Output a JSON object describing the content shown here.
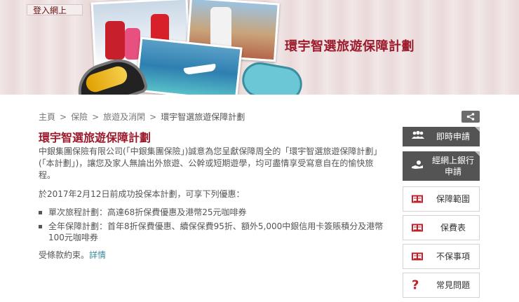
{
  "header": {
    "login_tab": "登入網上",
    "banner_title": "環宇智選旅遊保障計劃"
  },
  "breadcrumb": {
    "items": [
      "主頁",
      "保險",
      "旅遊及消閑"
    ],
    "current": "環宇智選旅遊保障計劃",
    "separator": ">"
  },
  "main": {
    "title": "環宇智選旅遊保障計劃",
    "intro": "中銀集團保險有限公司(「中銀集團保險」)誠意為您呈獻保障周全的「環宇智選旅遊保障計劃」(「本計劃」)，讓您及家人無論出外旅遊、公幹或短期遊學，均可盡情享受寫意自在的愉快旅程。",
    "offer_heading": "於2017年2月12日前成功投保本計劃，可享下列優惠：",
    "offers": [
      "單次旅程計劃：高達68折保費優惠及港幣25元咖啡券",
      "全年保障計劃：首年8折保費優惠、續保保費95折、額外5,000中銀信用卡簽賬積分及港幣100元咖啡券"
    ],
    "terms_text": "受條款約束。",
    "terms_link": "詳情"
  },
  "sidebar": {
    "apply_now": "即時申請",
    "online_banking_apply": "經網上銀行申請",
    "coverage": "保障範圍",
    "premium_table": "保費表",
    "exclusions": "不保事項",
    "faq": "常見問題"
  },
  "colors": {
    "brand_red": "#9c1a2b",
    "sidebar_dark": "#545454",
    "link": "#3a8a9a"
  }
}
